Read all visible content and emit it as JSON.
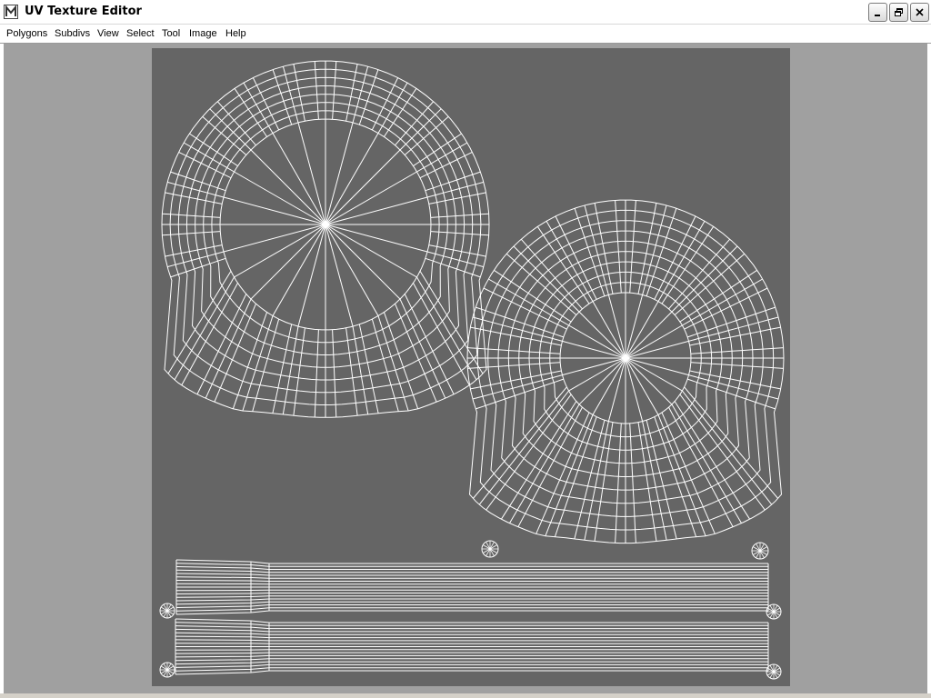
{
  "window": {
    "title": "UV Texture Editor",
    "icon": "maya-logo-icon",
    "controls": [
      "minimize-icon",
      "restore-icon",
      "close-icon"
    ]
  },
  "menubar": {
    "items": [
      {
        "label": "Polygons"
      },
      {
        "label": "Subdivs"
      },
      {
        "label": "View"
      },
      {
        "label": "Select"
      },
      {
        "label": "Tool"
      },
      {
        "label": "Image"
      },
      {
        "label": "Help"
      }
    ]
  },
  "viewport": {
    "background_color": "#a0a0a0",
    "uv_tile_color": "#656565",
    "wire_color": "#ffffff"
  }
}
